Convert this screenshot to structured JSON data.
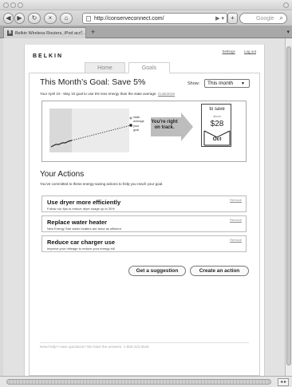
{
  "browser": {
    "url": "http://conserveconnect.com/",
    "search_placeholder": "Google",
    "tab_title": "Belkin Wireless Routers, iPod acc...",
    "new_tab_label": "+"
  },
  "site": {
    "logo": "BELKIN",
    "links": [
      "Settings",
      "Log out"
    ],
    "nav_tabs": [
      "Home",
      "Goals"
    ]
  },
  "goal": {
    "title": "This Month’s Goal: Save 5%",
    "show_label": "Show:",
    "show_value": "This month",
    "subtitle": "Your April 10 - May 10 goal to use 5% less energy than the state average.",
    "customize_link": "Customize",
    "state_average_label": "state\naverage",
    "your_goal_label": "your\ngoal",
    "status": "You’re right\non track.",
    "save_title": "to save",
    "save_about": "about",
    "save_amount": "$28",
    "save_month": "Oct"
  },
  "actions": {
    "title": "Your Actions",
    "subtitle": "You’ve committed to these energy-saving actions to help you reach your goal.",
    "remove_label": "Remove",
    "items": [
      {
        "title": "Use dryer more efficiently",
        "desc": "Follow our tips to reduce dryer usage up to 30%"
      },
      {
        "title": "Replace water heater",
        "desc": "New Energy Star water heaters are twice as efficient"
      },
      {
        "title": "Reduce car charger use",
        "desc": "Improve your mileage to reduce your energy bill."
      }
    ],
    "suggest_button": "Get a suggestion",
    "create_button": "Create an action"
  },
  "footer": {
    "text": "Need help? Have questions? We have the answers. 1-800-223-5546"
  }
}
